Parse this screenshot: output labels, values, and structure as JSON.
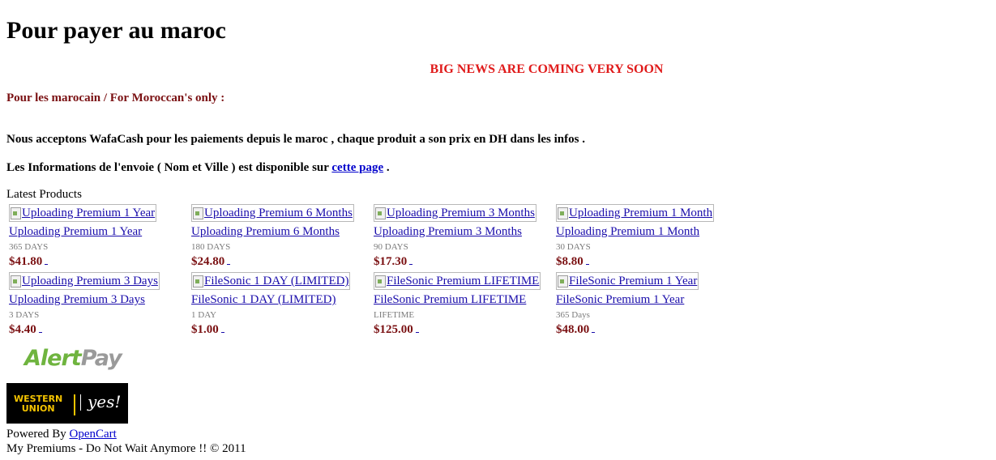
{
  "page": {
    "title": "Pour payer au maroc",
    "news_banner": "BIG NEWS ARE COMING VERY SOON",
    "moroccan_note": "Pour les marocain / For Moroccan's only :",
    "payment_text": "Nous acceptons WafaCash pour les paiements depuis le maroc , chaque produit a son prix en DH dans les infos  .",
    "info_text_before": "Les Informations de l'envoie ( Nom et Ville ) est disponible sur ",
    "info_link": "cette page",
    "info_text_after": " ."
  },
  "colors": {
    "news": "#e01b1b",
    "price": "#7a1012",
    "link": "#1a0dab"
  },
  "latest": {
    "heading": "Latest Products",
    "products": [
      {
        "image_alt": "Uploading Premium 1 Year",
        "name": "Uploading Premium 1 Year",
        "desc": "365 DAYS",
        "price": "$41.80"
      },
      {
        "image_alt": "Uploading Premium 6 Months",
        "name": "Uploading Premium 6 Months",
        "desc": "180 DAYS",
        "price": "$24.80"
      },
      {
        "image_alt": "Uploading Premium 3 Months",
        "name": "Uploading Premium 3 Months",
        "desc": "90 DAYS",
        "price": "$17.30"
      },
      {
        "image_alt": "Uploading Premium 1 Month",
        "name": "Uploading Premium 1 Month",
        "desc": "30 DAYS",
        "price": "$8.80"
      },
      {
        "image_alt": "Uploading Premium 3 Days",
        "name": "Uploading Premium 3 Days",
        "desc": "3 DAYS",
        "price": "$4.40"
      },
      {
        "image_alt": "FileSonic 1 DAY (LIMITED)",
        "name": "FileSonic 1 DAY (LIMITED)",
        "desc": "1 DAY",
        "price": "$1.00"
      },
      {
        "image_alt": "FileSonic Premium LIFETIME",
        "name": "FileSonic Premium LIFETIME",
        "desc": "LIFETIME",
        "price": "$125.00"
      },
      {
        "image_alt": "FileSonic Premium 1 Year",
        "name": "FileSonic Premium 1 Year",
        "desc": "365 Days",
        "price": "$48.00"
      }
    ]
  },
  "payment_logos": {
    "alertpay_part1": "Alert",
    "alertpay_part2": "Pay",
    "western_union_line1": "WESTERN",
    "western_union_line2": "UNION",
    "western_union_tagline": "yes!"
  },
  "footer": {
    "powered_label": "Powered By ",
    "powered_link": "OpenCart",
    "copyright": "My Premiums - Do Not Wait Anymore !! © 2011"
  }
}
